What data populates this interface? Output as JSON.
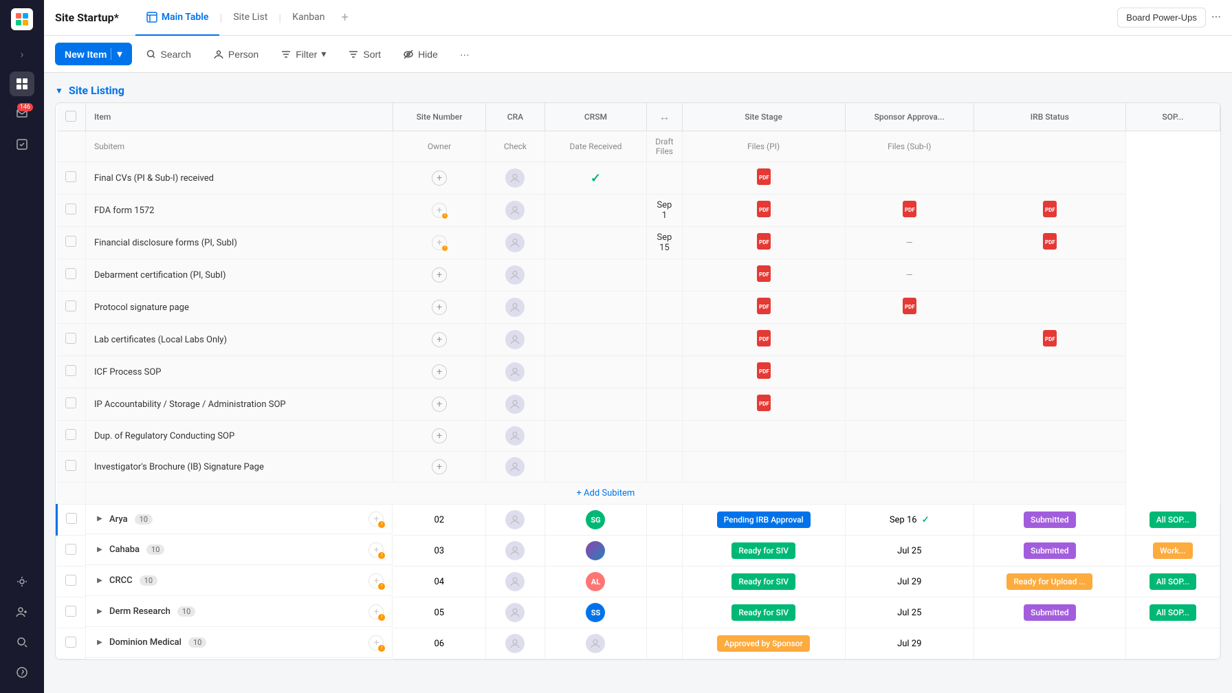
{
  "app": {
    "title": "Site Startup*",
    "logo": "SS"
  },
  "tabs": [
    {
      "id": "main-table",
      "label": "Main Table",
      "icon": "table",
      "active": true
    },
    {
      "id": "site-list",
      "label": "Site List",
      "active": false
    },
    {
      "id": "kanban",
      "label": "Kanban",
      "active": false
    }
  ],
  "topnav": {
    "board_power_ups": "Board Power-Ups",
    "dots": "···"
  },
  "toolbar": {
    "new_item": "New Item",
    "search": "Search",
    "person": "Person",
    "filter": "Filter",
    "sort": "Sort",
    "hide": "Hide",
    "more": "···"
  },
  "group": {
    "title": "Site Listing"
  },
  "table": {
    "columns": [
      {
        "id": "item",
        "label": "Item"
      },
      {
        "id": "site_number",
        "label": "Site Number"
      },
      {
        "id": "cra",
        "label": "CRA"
      },
      {
        "id": "crsm",
        "label": "CRSM"
      },
      {
        "id": "site_stage",
        "label": "Site Stage"
      },
      {
        "id": "sponsor_approval",
        "label": "Sponsor Approva..."
      },
      {
        "id": "irb_status",
        "label": "IRB Status"
      },
      {
        "id": "sop",
        "label": "SOP..."
      }
    ],
    "subitem_columns": [
      {
        "id": "subitem",
        "label": "Subitem"
      },
      {
        "id": "owner",
        "label": "Owner"
      },
      {
        "id": "check",
        "label": "Check"
      },
      {
        "id": "date_received",
        "label": "Date Received"
      },
      {
        "id": "draft_files",
        "label": "Draft Files"
      },
      {
        "id": "files_pi",
        "label": "Files (PI)"
      },
      {
        "id": "files_subi",
        "label": "Files (Sub-I)"
      }
    ],
    "subitems": [
      {
        "id": 1,
        "name": "Final CVs (PI & Sub-I) received",
        "owner": null,
        "check": "✓",
        "date_received": "",
        "draft_files": "pdf",
        "files_pi": "",
        "files_subi": ""
      },
      {
        "id": 2,
        "name": "FDA form 1572",
        "owner": null,
        "check": "",
        "date_received": "Sep 1",
        "draft_files": "pdf",
        "files_pi": "pdf",
        "files_subi": "pdf"
      },
      {
        "id": 3,
        "name": "Financial disclosure forms (PI, SubI)",
        "owner": null,
        "check": "",
        "date_received": "Sep 15",
        "draft_files": "pdf",
        "files_pi": "—",
        "files_subi": "pdf"
      },
      {
        "id": 4,
        "name": "Debarment certification (PI, SubI)",
        "owner": null,
        "check": "",
        "date_received": "",
        "draft_files": "pdf",
        "files_pi": "—",
        "files_subi": ""
      },
      {
        "id": 5,
        "name": "Protocol signature page",
        "owner": null,
        "check": "",
        "date_received": "",
        "draft_files": "pdf",
        "files_pi": "pdf",
        "files_subi": ""
      },
      {
        "id": 6,
        "name": "Lab certificates (Local Labs Only)",
        "owner": null,
        "check": "",
        "date_received": "",
        "draft_files": "pdf",
        "files_pi": "",
        "files_subi": "pdf"
      },
      {
        "id": 7,
        "name": "ICF Process SOP",
        "owner": null,
        "check": "",
        "date_received": "",
        "draft_files": "pdf",
        "files_pi": "",
        "files_subi": ""
      },
      {
        "id": 8,
        "name": "IP Accountability / Storage / Administration SOP",
        "owner": null,
        "check": "",
        "date_received": "",
        "draft_files": "pdf",
        "files_pi": "",
        "files_subi": ""
      },
      {
        "id": 9,
        "name": "Dup. of Regulatory Conducting SOP",
        "owner": null,
        "check": "",
        "date_received": "",
        "draft_files": "",
        "files_pi": "",
        "files_subi": ""
      },
      {
        "id": 10,
        "name": "Investigator's Brochure (IB) Signature Page",
        "owner": null,
        "check": "",
        "date_received": "",
        "draft_files": "",
        "files_pi": "",
        "files_subi": ""
      }
    ],
    "add_subitem": "+ Add Subitem",
    "main_rows": [
      {
        "id": 1,
        "name": "Arya",
        "count": 10,
        "site_number": "02",
        "cra": null,
        "crsm": "SG",
        "crsm_color": "#00c875",
        "site_stage": "Pending IRB Approval",
        "stage_color": "#0073ea",
        "sponsor_approval_date": "Sep 16",
        "sponsor_check": true,
        "irb_status": "Submitted",
        "irb_color": "#a25ddc",
        "sop": "All SOP...",
        "sop_color": "#00c875"
      },
      {
        "id": 2,
        "name": "Cahaba",
        "count": 10,
        "site_number": "03",
        "cra": null,
        "crsm": null,
        "crsm_color": null,
        "crsm_img": true,
        "site_stage": "Ready for SIV",
        "stage_color": "#00c875",
        "sponsor_approval_date": "Jul 25",
        "sponsor_check": false,
        "irb_status": "Submitted",
        "irb_color": "#a25ddc",
        "sop": "Work...",
        "sop_color": "#fdab3d"
      },
      {
        "id": 3,
        "name": "CRCC",
        "count": 10,
        "site_number": "04",
        "cra": null,
        "crsm": "AL",
        "crsm_color": "#ff7575",
        "site_stage": "Ready for SIV",
        "stage_color": "#00c875",
        "sponsor_approval_date": "Jul 29",
        "sponsor_check": false,
        "irb_status": "Ready for Upload ...",
        "irb_color": "#fdab3d",
        "sop": "All SOP...",
        "sop_color": "#00c875"
      },
      {
        "id": 4,
        "name": "Derm Research",
        "count": 10,
        "site_number": "05",
        "cra": null,
        "crsm": "SS",
        "crsm_color": "#0073ea",
        "site_stage": "Ready for SIV",
        "stage_color": "#00c875",
        "sponsor_approval_date": "Jul 25",
        "sponsor_check": false,
        "irb_status": "Submitted",
        "irb_color": "#a25ddc",
        "sop": "All SOP...",
        "sop_color": "#00c875"
      },
      {
        "id": 5,
        "name": "Dominion Medical",
        "count": 10,
        "site_number": "06",
        "cra": null,
        "crsm": null,
        "crsm_color": null,
        "site_stage": "Approved by Sponsor",
        "stage_color": "#fdab3d",
        "sponsor_approval_date": "Jul 29",
        "sponsor_check": false,
        "irb_status": "",
        "irb_color": null,
        "sop": "",
        "sop_color": null
      }
    ]
  },
  "sidebar": {
    "icons": [
      {
        "id": "logo",
        "symbol": "⊞",
        "active": false
      },
      {
        "id": "expand",
        "symbol": "›",
        "active": false
      },
      {
        "id": "home",
        "symbol": "⊞",
        "active": true
      },
      {
        "id": "inbox",
        "symbol": "🔔",
        "active": false,
        "badge": "146"
      },
      {
        "id": "tasks",
        "symbol": "✓",
        "active": false
      },
      {
        "id": "plugins",
        "symbol": "⚙",
        "active": false
      },
      {
        "id": "add-member",
        "symbol": "+",
        "active": false
      },
      {
        "id": "search",
        "symbol": "🔍",
        "active": false
      },
      {
        "id": "help",
        "symbol": "?",
        "active": false
      }
    ]
  }
}
